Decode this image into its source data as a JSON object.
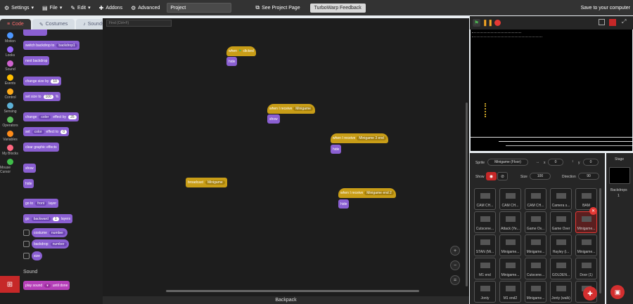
{
  "menu": {
    "settings": "Settings",
    "file": "File",
    "edit": "Edit",
    "addons": "Addons",
    "advanced": "Advanced",
    "project_title": "Project",
    "see_project_page": "See Project Page",
    "feedback": "TurboWarp Feedback",
    "save": "Save to your computer"
  },
  "tabs": [
    "Code",
    "Costumes",
    "Sounds"
  ],
  "categories": [
    {
      "label": "Motion",
      "color": "#4c97ff"
    },
    {
      "label": "Looks",
      "color": "#9966ff"
    },
    {
      "label": "Sound",
      "color": "#cf63cf"
    },
    {
      "label": "Events",
      "color": "#ffbf00"
    },
    {
      "label": "Control",
      "color": "#ffab19"
    },
    {
      "label": "Sensing",
      "color": "#5cb1d6"
    },
    {
      "label": "Operators",
      "color": "#59c059"
    },
    {
      "label": "Variables",
      "color": "#ff8c1a"
    },
    {
      "label": "My Blocks",
      "color": "#ff6680"
    },
    {
      "label": "Mouse Cursor",
      "color": "#40bf4a"
    }
  ],
  "palette": {
    "switch_backdrop": "switch backdrop to",
    "backdrop_value": "backdrop1",
    "next_backdrop": "next backdrop",
    "change_size": "change size by",
    "change_size_val": "10",
    "set_size": "set size to",
    "set_size_val": "100",
    "percent": "%",
    "change": "change",
    "color": "color",
    "effect_by": "effect by",
    "effect_by_val": "25",
    "set": "set",
    "effect_to": "effect to",
    "effect_to_val": "0",
    "clear_effects": "clear graphic effects",
    "show": "show",
    "hide": "hide",
    "go_to": "go to",
    "front": "front",
    "layer": "layer",
    "go": "go",
    "backward": "backward",
    "layers_val": "1",
    "layers": "layers",
    "costume": "costume",
    "number": "number",
    "backdrop": "backdrop",
    "size": "size",
    "sound_header": "Sound",
    "play_sound": "play sound",
    "until_done": "until done"
  },
  "workspace": {
    "find_placeholder": "Find (Ctrl+F)",
    "when_flag": "when",
    "clicked": "clicked",
    "hide": "hide",
    "show": "show",
    "when_receive": "when I receive",
    "msg1": "Minigame",
    "msg2": "Minigame 3 end",
    "broadcast": "broadcast",
    "msg3": "Minigame",
    "msg4": "Minigame end 2",
    "backpack": "Backpack"
  },
  "sprite_info": {
    "sprite_label": "Sprite",
    "sprite_name": "Minigame (Floor)",
    "x_label": "x",
    "x_val": "0",
    "y_label": "y",
    "y_val": "0",
    "show_label": "Show",
    "size_label": "Size",
    "size_val": "100",
    "direction_label": "Direction",
    "direction_val": "90"
  },
  "sprites": [
    "CAM CH...",
    "CAM CH...",
    "CAM CH...",
    "Camera s...",
    "BAM",
    "Cutscene...",
    "Attack (Ye...",
    "Game Ov...",
    "Game Over",
    "Minigame...",
    "STAN (Mi...",
    "Minigame...",
    "Minigame...",
    "Hayley (i...",
    "Minigame...",
    "M1 end",
    "Minigame...",
    "Cutscene...",
    "GOLDEN...",
    "Door (1)",
    "Jonty",
    "M1 end2",
    "Minigame...",
    "Jonty (walk)",
    ""
  ],
  "stage_pane": {
    "label": "Stage",
    "backdrops_label": "Backdrops",
    "backdrops_count": "1"
  }
}
